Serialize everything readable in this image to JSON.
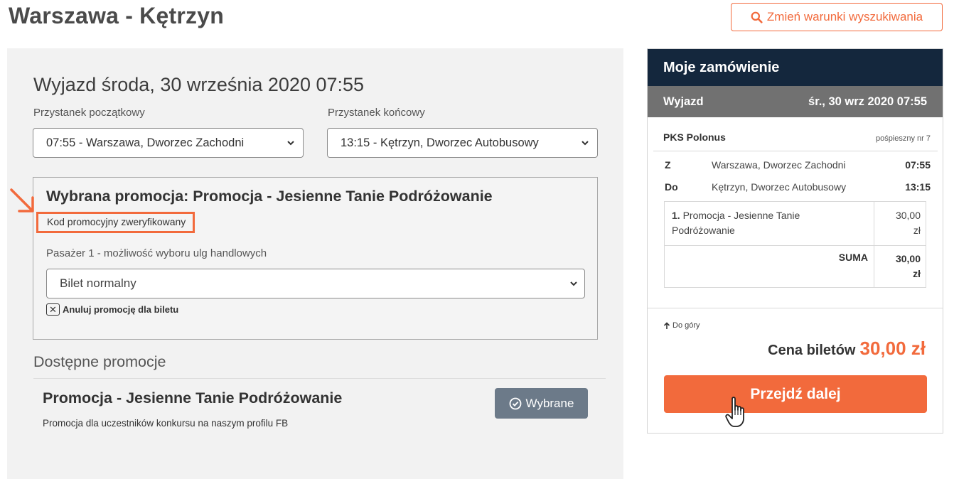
{
  "header": {
    "title": "Warszawa - Kętrzyn",
    "change_search_label": "Zmień warunki wyszukiwania"
  },
  "departure": {
    "title": "Wyjazd środa, 30 września 2020 07:55",
    "start_stop_label": "Przystanek początkowy",
    "start_stop_value": "07:55 - Warszawa, Dworzec Zachodni",
    "end_stop_label": "Przystanek końcowy",
    "end_stop_value": "13:15 - Kętrzyn, Dworzec Autobusowy"
  },
  "selected_promo": {
    "title": "Wybrana promocja: Promocja - Jesienne Tanie Podróżowanie",
    "verified_text": "Kod promocyjny zweryfikowany",
    "passenger_label": "Pasażer 1 - możliwość wyboru ulg handlowych",
    "ticket_value": "Bilet normalny",
    "cancel_label": "Anuluj promocję dla biletu"
  },
  "available_promos": {
    "title": "Dostępne promocje",
    "items": [
      {
        "name": "Promocja - Jesienne Tanie Podróżowanie",
        "description": "Promocja dla uczestników konkursu na naszym profilu FB",
        "button_label": "Wybrane"
      }
    ]
  },
  "order": {
    "title": "Moje zamówienie",
    "departure_label": "Wyjazd",
    "departure_value": "śr., 30 wrz 2020 07:55",
    "carrier": "PKS Polonus",
    "service_type": "pośpieszny nr 7",
    "from_label": "Z",
    "from_stop": "Warszawa, Dworzec Zachodni",
    "from_time": "07:55",
    "to_label": "Do",
    "to_stop": "Kętrzyn, Dworzec Autobusowy",
    "to_time": "13:15",
    "item_number": "1.",
    "item_name": "Promocja - Jesienne Tanie Podróżowanie",
    "item_price": "30,00",
    "item_currency": "zł",
    "sum_label": "SUMA",
    "sum_value": "30,00",
    "sum_currency": "zł",
    "to_top_label": "Do góry",
    "total_label": "Cena biletów",
    "total_value": "30,00 zł",
    "proceed_label": "Przejdź dalej"
  },
  "colors": {
    "accent": "#f26a3c",
    "navy": "#14273d",
    "gray_band": "#717171",
    "button_gray": "#6c7a89"
  }
}
